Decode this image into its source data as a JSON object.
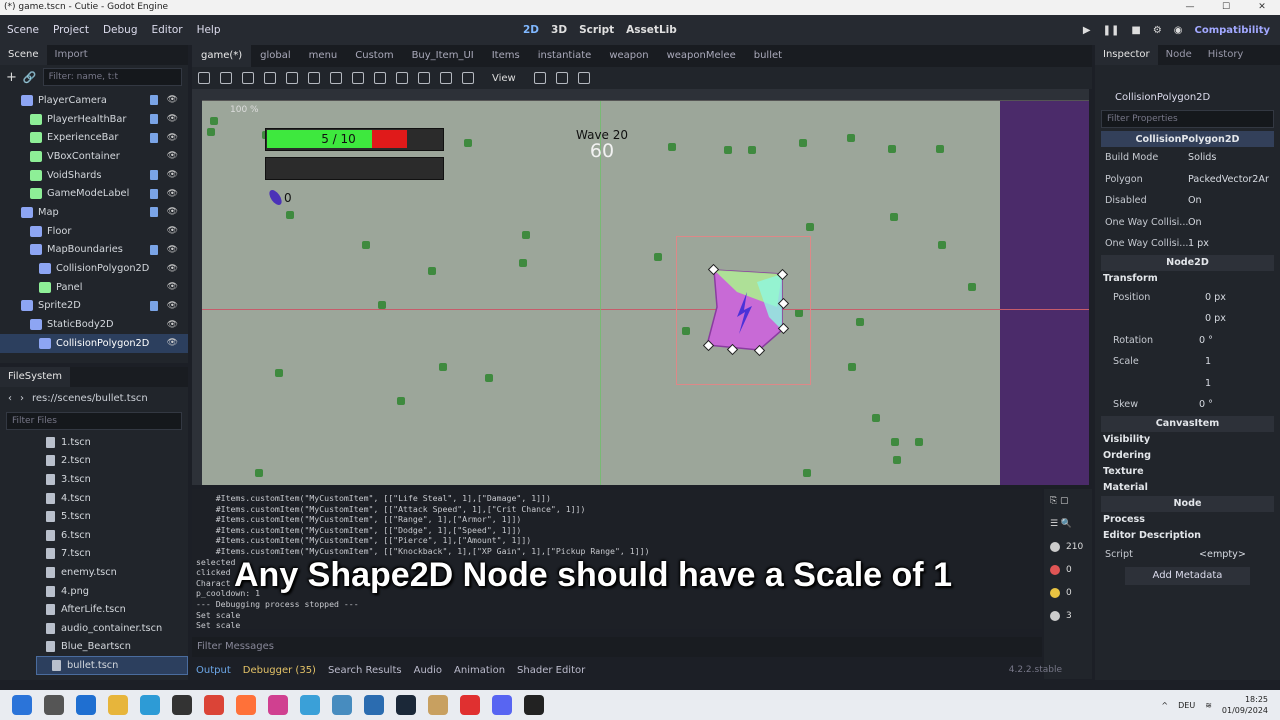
{
  "window": {
    "title": "(*) game.tscn - Cutie - Godot Engine",
    "controls": [
      "—",
      "☐",
      "✕"
    ]
  },
  "menubar": {
    "items": [
      "Scene",
      "Project",
      "Debug",
      "Editor",
      "Help"
    ],
    "workspaces": [
      {
        "label": "2D",
        "active": true
      },
      {
        "label": "3D"
      },
      {
        "label": "Script"
      },
      {
        "label": "AssetLib"
      }
    ],
    "renderer": "Compatibility"
  },
  "scene_panel": {
    "tabs": [
      "Scene",
      "Import"
    ],
    "filter_placeholder": "Filter: name, t:t",
    "tree": [
      {
        "label": "PlayerCamera",
        "indent": 1,
        "color": "#8da5f3",
        "script": true
      },
      {
        "label": "PlayerHealthBar",
        "indent": 2,
        "color": "#8eef97",
        "script": true
      },
      {
        "label": "ExperienceBar",
        "indent": 2,
        "color": "#8eef97",
        "script": true
      },
      {
        "label": "VBoxContainer",
        "indent": 2,
        "color": "#8eef97",
        "script": false
      },
      {
        "label": "VoidShards",
        "indent": 2,
        "color": "#8eef97",
        "script": true
      },
      {
        "label": "GameModeLabel",
        "indent": 2,
        "color": "#8eef97",
        "script": true
      },
      {
        "label": "Map",
        "indent": 1,
        "color": "#8da5f3",
        "script": true
      },
      {
        "label": "Floor",
        "indent": 2,
        "color": "#8da5f3",
        "script": false
      },
      {
        "label": "MapBoundaries",
        "indent": 2,
        "color": "#8da5f3",
        "script": true
      },
      {
        "label": "CollisionPolygon2D",
        "indent": 3,
        "color": "#8da5f3",
        "script": false
      },
      {
        "label": "Panel",
        "indent": 3,
        "color": "#8eef97",
        "script": false
      },
      {
        "label": "Sprite2D",
        "indent": 1,
        "color": "#8da5f3",
        "script": true
      },
      {
        "label": "StaticBody2D",
        "indent": 2,
        "color": "#8da5f3",
        "script": false
      },
      {
        "label": "CollisionPolygon2D",
        "indent": 3,
        "color": "#8da5f3",
        "script": false,
        "selected": true
      }
    ]
  },
  "filesystem": {
    "tab": "FileSystem",
    "path": "res://scenes/bullet.tscn",
    "filter_placeholder": "Filter Files",
    "files": [
      "1.tscn",
      "2.tscn",
      "3.tscn",
      "4.tscn",
      "5.tscn",
      "6.tscn",
      "7.tscn",
      "enemy.tscn",
      "4.png",
      "AfterLife.tscn",
      "audio_container.tscn",
      "Blue_Beartscn",
      "bullet.tscn"
    ],
    "selected": "bullet.tscn"
  },
  "editor_tabs": [
    "game(*)",
    "global",
    "menu",
    "Custom",
    "Buy_Item_UI",
    "Items",
    "instantiate",
    "weapon",
    "weaponMelee",
    "bullet"
  ],
  "viewport_toolbar": {
    "view": "View",
    "zoom": "100 %"
  },
  "game": {
    "health_text": "5 / 10",
    "wave_label": "Wave 20",
    "wave_timer": "60",
    "shards": "0",
    "hp_fraction": 0.5
  },
  "output": {
    "lines": [
      "    #Items.customItem(\"MyCustomItem\", [[\"Life Steal\", 1],[\"Damage\", 1]])",
      "    #Items.customItem(\"MyCustomItem\", [[\"Attack Speed\", 1],[\"Crit Chance\", 1]])",
      "    #Items.customItem(\"MyCustomItem\", [[\"Range\", 1],[\"Armor\", 1]])",
      "    #Items.customItem(\"MyCustomItem\", [[\"Dodge\", 1],[\"Speed\", 1]])",
      "    #Items.customItem(\"MyCustomItem\", [[\"Pierce\", 1],[\"Amount\", 1]])",
      "    #Items.customItem(\"MyCustomItem\", [[\"Knockback\", 1],[\"XP Gain\", 1],[\"Pickup Range\", 1]])",
      "selected",
      "clicked",
      "Charact",
      "p_cooldown: 1",
      "--- Debugging process stopped ---",
      "Set scale",
      "Set scale"
    ],
    "filter_placeholder": "Filter Messages",
    "counts": [
      "210",
      "0",
      "0",
      "3"
    ]
  },
  "bottom_tabs": [
    {
      "label": "Output",
      "active": true
    },
    {
      "label": "Debugger (35)"
    },
    {
      "label": "Search Results"
    },
    {
      "label": "Audio"
    },
    {
      "label": "Animation"
    },
    {
      "label": "Shader Editor"
    }
  ],
  "version": "4.2.2.stable",
  "inspector": {
    "tabs": [
      "Inspector",
      "Node",
      "History"
    ],
    "node": "CollisionPolygon2D",
    "filter_placeholder": "Filter Properties",
    "class_header": "CollisionPolygon2D",
    "props": [
      {
        "label": "Build Mode",
        "value": "Solids"
      },
      {
        "label": "Polygon",
        "value": "PackedVector2Ar"
      },
      {
        "label": "Disabled",
        "value": "On"
      },
      {
        "label": "One Way Collisi...",
        "value": "On"
      },
      {
        "label": "One Way Collisi...",
        "value": "1 px"
      }
    ],
    "node2d_header": "Node2D",
    "transform_label": "Transform",
    "transform": [
      {
        "label": "Position",
        "x": "0 px",
        "y": "0 px"
      },
      {
        "label": "Rotation",
        "value": "0 °"
      },
      {
        "label": "Scale",
        "x": "1",
        "y": "1"
      },
      {
        "label": "Skew",
        "value": "0 °"
      }
    ],
    "canvasitem_header": "CanvasItem",
    "canvas_sections": [
      "Visibility",
      "Ordering",
      "Texture",
      "Material"
    ],
    "node_header": "Node",
    "node_sections": [
      "Process",
      "Editor Description"
    ],
    "script_label": "Script",
    "script_value": "<empty>",
    "add_metadata": "Add Metadata"
  },
  "subtitle": "Any Shape2D Node should have a Scale of 1",
  "taskbar": {
    "lang": "DEU",
    "time": "18:25",
    "date": "01/09/2024"
  }
}
